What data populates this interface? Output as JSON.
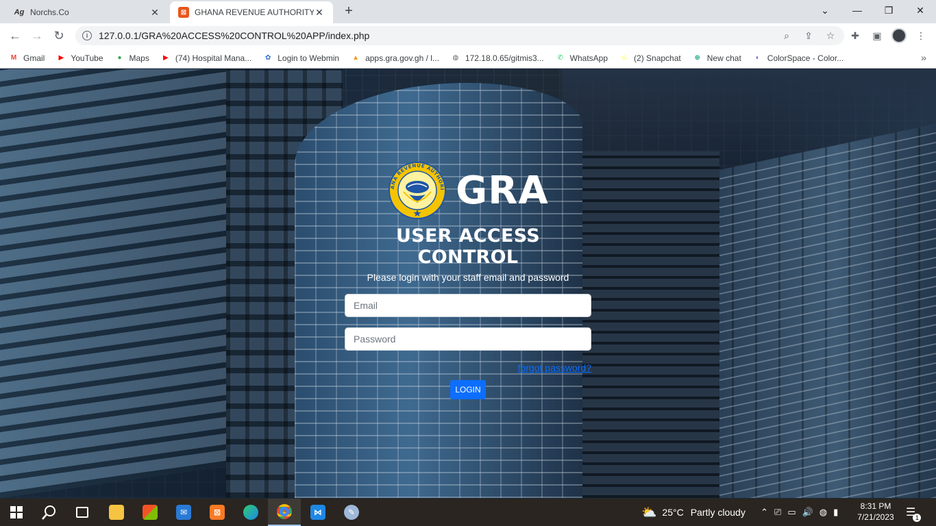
{
  "browser": {
    "tabs": [
      {
        "title": "Norchs.Co",
        "icon": "ag-logo-icon",
        "active": false
      },
      {
        "title": "GHANA REVENUE AUTHORITY",
        "icon": "xampp-icon",
        "active": true
      }
    ],
    "new_tab": "+",
    "address": "127.0.0.1/GRA%20ACCESS%20CONTROL%20APP/index.php",
    "bookmarks": [
      {
        "label": "Gmail",
        "icon": "gmail-icon",
        "color": "#ea4335",
        "glyph": "M"
      },
      {
        "label": "YouTube",
        "icon": "youtube-icon",
        "color": "#ff0000",
        "glyph": "▶"
      },
      {
        "label": "Maps",
        "icon": "maps-icon",
        "color": "#34a853",
        "glyph": "●"
      },
      {
        "label": "(74) Hospital Mana...",
        "icon": "youtube-icon",
        "color": "#ff0000",
        "glyph": "▶"
      },
      {
        "label": "Login to Webmin",
        "icon": "webmin-icon",
        "color": "#2d6fdc",
        "glyph": "✿"
      },
      {
        "label": "apps.gra.gov.gh / l...",
        "icon": "phpmyadmin-icon",
        "color": "#f39c12",
        "glyph": "▲"
      },
      {
        "label": "172.18.0.65/gitmis3...",
        "icon": "globe-icon",
        "color": "#5f6368",
        "glyph": "◍"
      },
      {
        "label": "WhatsApp",
        "icon": "whatsapp-icon",
        "color": "#25d366",
        "glyph": "✆"
      },
      {
        "label": "(2) Snapchat",
        "icon": "snapchat-icon",
        "color": "#fffc00",
        "glyph": "☺"
      },
      {
        "label": "New chat",
        "icon": "chatgpt-icon",
        "color": "#10a37f",
        "glyph": "⊛"
      },
      {
        "label": "ColorSpace - Color...",
        "icon": "colorspace-icon",
        "color": "#7b5cd6",
        "glyph": "◐"
      }
    ]
  },
  "login": {
    "brand": "GRA",
    "seal_top_text": "GHANA REVENUE AUTHORITY",
    "heading": "USER ACCESS CONTROL",
    "subtitle": "Please login with your staff email and password",
    "email_placeholder": "Email",
    "password_placeholder": "Password",
    "forgot": "forgot password?",
    "button": "LOGIN"
  },
  "taskbar": {
    "weather": "25°C",
    "weather_desc": "Partly cloudy",
    "time": "8:31 PM",
    "date": "7/21/2023",
    "notifications": "1"
  },
  "colors": {
    "accent": "#0d6efd",
    "seal_yellow": "#f5c400",
    "seal_blue": "#1f56a6"
  }
}
